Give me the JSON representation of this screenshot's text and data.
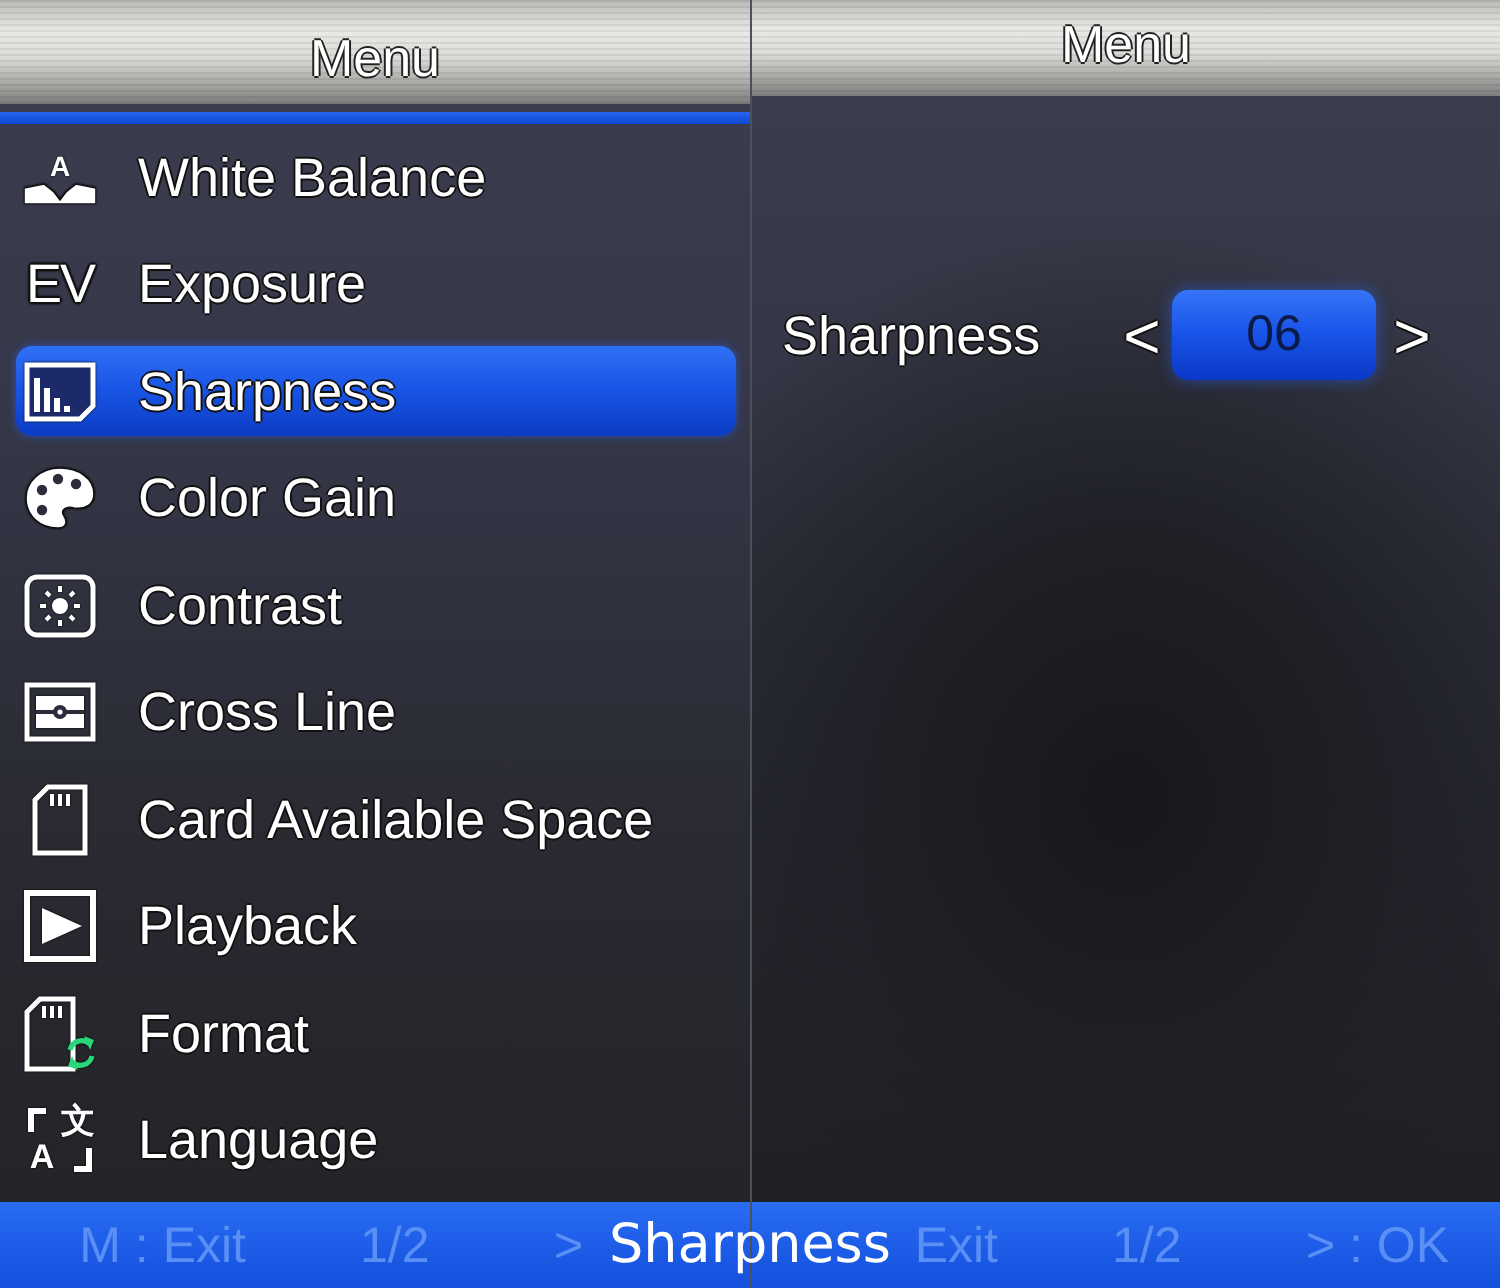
{
  "left_panel": {
    "title": "Menu",
    "items": [
      {
        "label": "White Balance",
        "selected": false,
        "icon_glyphs": [
          "A"
        ]
      },
      {
        "label": "Exposure",
        "selected": false,
        "icon_glyphs": [
          "EV"
        ]
      },
      {
        "label": "Sharpness",
        "selected": true
      },
      {
        "label": "Color Gain",
        "selected": false
      },
      {
        "label": "Contrast",
        "selected": false
      },
      {
        "label": "Cross Line",
        "selected": false
      },
      {
        "label": "Card Available Space",
        "selected": false
      },
      {
        "label": "Playback",
        "selected": false
      },
      {
        "label": "Format",
        "selected": false
      },
      {
        "label": "Language",
        "selected": false,
        "icon_glyphs": [
          "文",
          "A"
        ]
      }
    ],
    "footer": [
      "M : Exit",
      "1/2",
      ">"
    ]
  },
  "right_panel": {
    "title": "Menu",
    "setting": {
      "label": "Sharpness",
      "decrease": "<",
      "value": "06",
      "increase": ">"
    },
    "footer": [
      "Exit",
      "1/2",
      "> : OK"
    ]
  },
  "caption": "Sharpness"
}
